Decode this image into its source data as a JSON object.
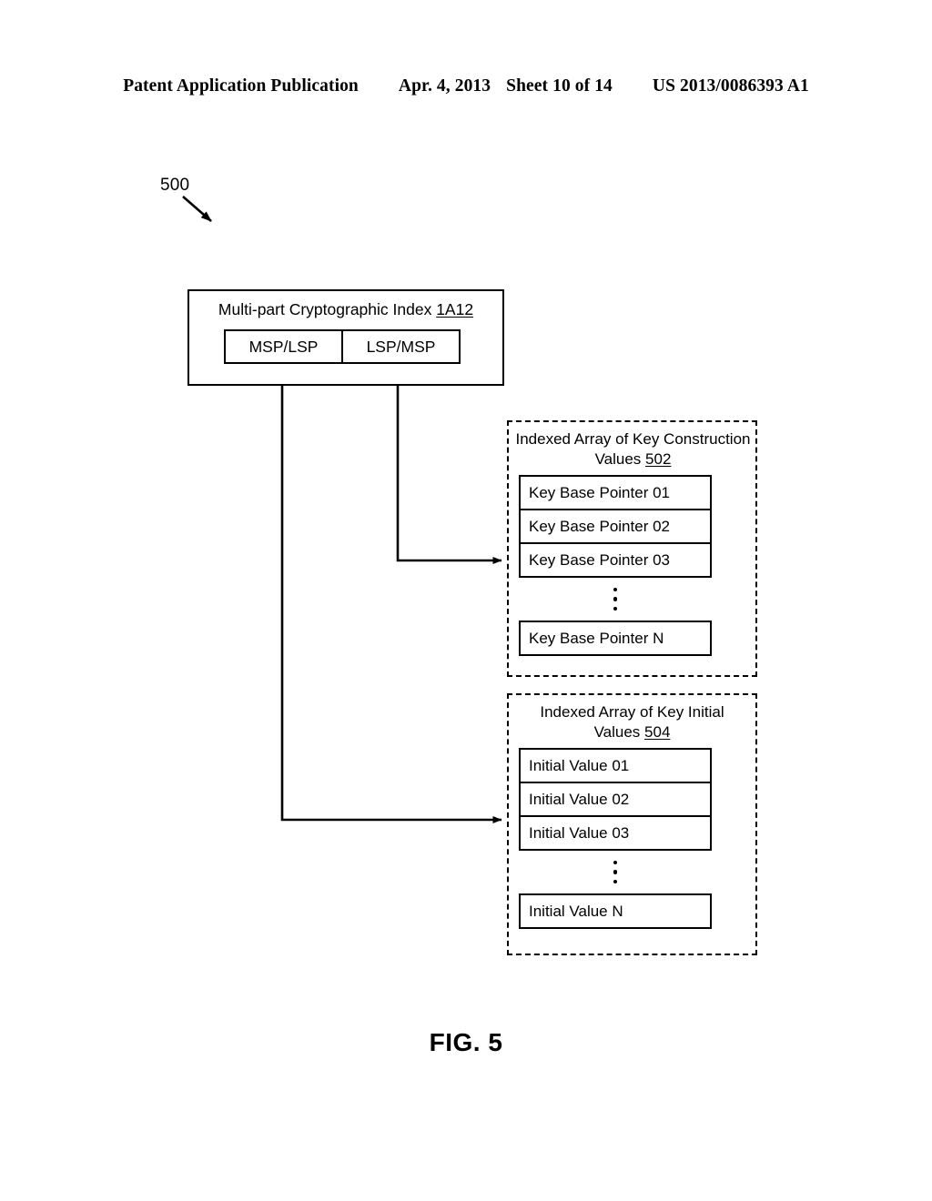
{
  "header": {
    "publication": "Patent Application Publication",
    "date": "Apr. 4, 2013",
    "sheet": "Sheet 10 of 14",
    "doc_number": "US 2013/0086393 A1"
  },
  "figure": {
    "ref_label": "500",
    "caption": "FIG. 5",
    "ink_color": "#000000",
    "background_color": "#ffffff"
  },
  "crypto_index": {
    "title_text": "Multi-part Cryptographic Index ",
    "title_ref": "1A12",
    "parts": [
      {
        "label": "MSP/LSP"
      },
      {
        "label": "LSP/MSP"
      }
    ]
  },
  "key_construction_array": {
    "title_line1": "Indexed Array of Key Construction",
    "title_line2": "Values ",
    "title_ref": "502",
    "cells": [
      {
        "label": "Key Base Pointer 01"
      },
      {
        "label": "Key Base Pointer 02"
      },
      {
        "label": "Key Base Pointer 03"
      }
    ],
    "ellipsis": "vertical-three-dots",
    "tail_cell": {
      "label": "Key Base Pointer N"
    }
  },
  "key_initial_array": {
    "title_line1": "Indexed Array of Key Initial",
    "title_line2": "Values ",
    "title_ref": "504",
    "cells": [
      {
        "label": "Initial Value 01"
      },
      {
        "label": "Initial Value 02"
      },
      {
        "label": "Initial Value 03"
      }
    ],
    "ellipsis": "vertical-three-dots",
    "tail_cell": {
      "label": "Initial Value N"
    }
  },
  "connectors": [
    {
      "name": "lsp-msp-to-key-construction",
      "from": "LSP/MSP",
      "to": "Indexed Array of Key Construction Values 502"
    },
    {
      "name": "msp-lsp-to-key-initial",
      "from": "MSP/LSP",
      "to": "Indexed Array of Key Initial Values 504"
    }
  ]
}
